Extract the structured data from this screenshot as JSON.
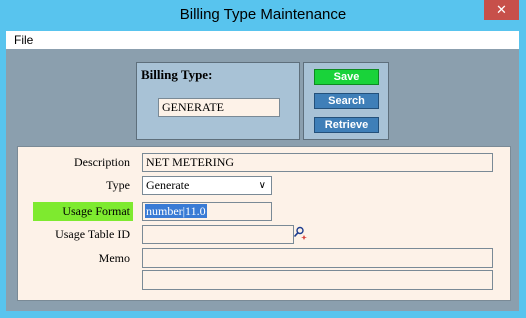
{
  "window": {
    "title": "Billing Type Maintenance",
    "close_label": "✕"
  },
  "menu": {
    "file": "File"
  },
  "billing_type": {
    "label": "Billing Type:",
    "value": "GENERATE"
  },
  "buttons": {
    "save": "Save",
    "search": "Search",
    "retrieve": "Retrieve"
  },
  "form": {
    "description_label": "Description",
    "description_value": "NET METERING",
    "type_label": "Type",
    "type_value": "Generate",
    "usage_format_label": "Usage Format",
    "usage_format_value": "number|11.0",
    "usage_table_label": "Usage Table ID",
    "usage_table_value": "",
    "memo_label": "Memo"
  },
  "colors": {
    "highlight": "#7eea2f",
    "save_button": "#19d33a",
    "action_button": "#3f7fb8",
    "panel": "#a8c2d6",
    "field_bg": "#fdf2e8"
  }
}
